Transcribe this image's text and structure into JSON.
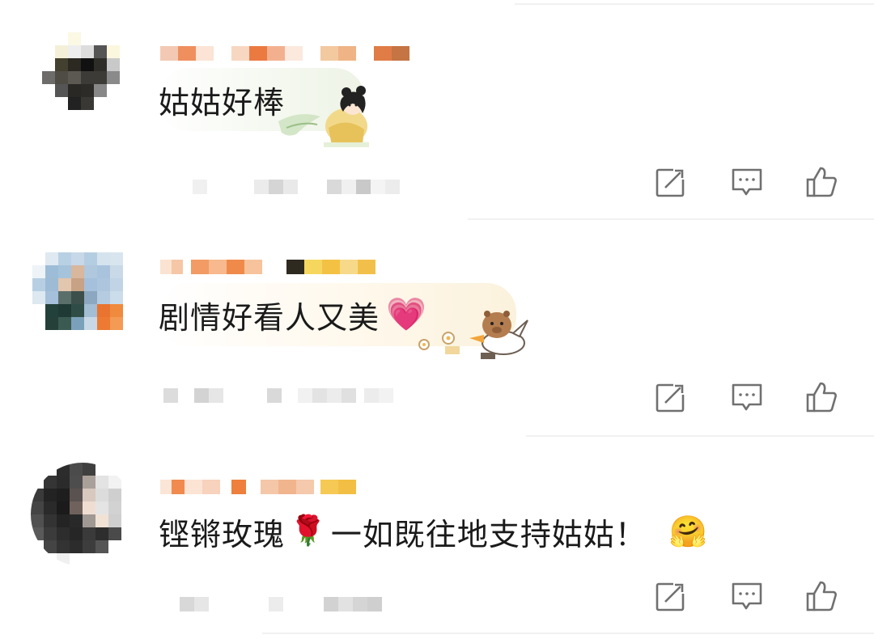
{
  "comments": [
    {
      "text": "姑姑好棒",
      "icons": [
        "share-icon",
        "reply-icon",
        "like-icon"
      ],
      "sticker": "girl-sticker"
    },
    {
      "text": "剧情好看人又美",
      "inline_emoji": "💗",
      "icons": [
        "share-icon",
        "reply-icon",
        "like-icon"
      ],
      "sticker": "capybara-duck-sticker"
    },
    {
      "text_before_emoji": "铿锵玫瑰",
      "inline_emoji": "🌹",
      "text_after_emoji": "一如既往地支持姑姑！",
      "trailing_emoji": "🤗",
      "icons": [
        "share-icon",
        "reply-icon",
        "like-icon"
      ]
    }
  ],
  "colors": {
    "icon_gray": "#6f6f6f",
    "divider": "#f1f1f1",
    "bubble_bg": "#f3f7ee"
  }
}
